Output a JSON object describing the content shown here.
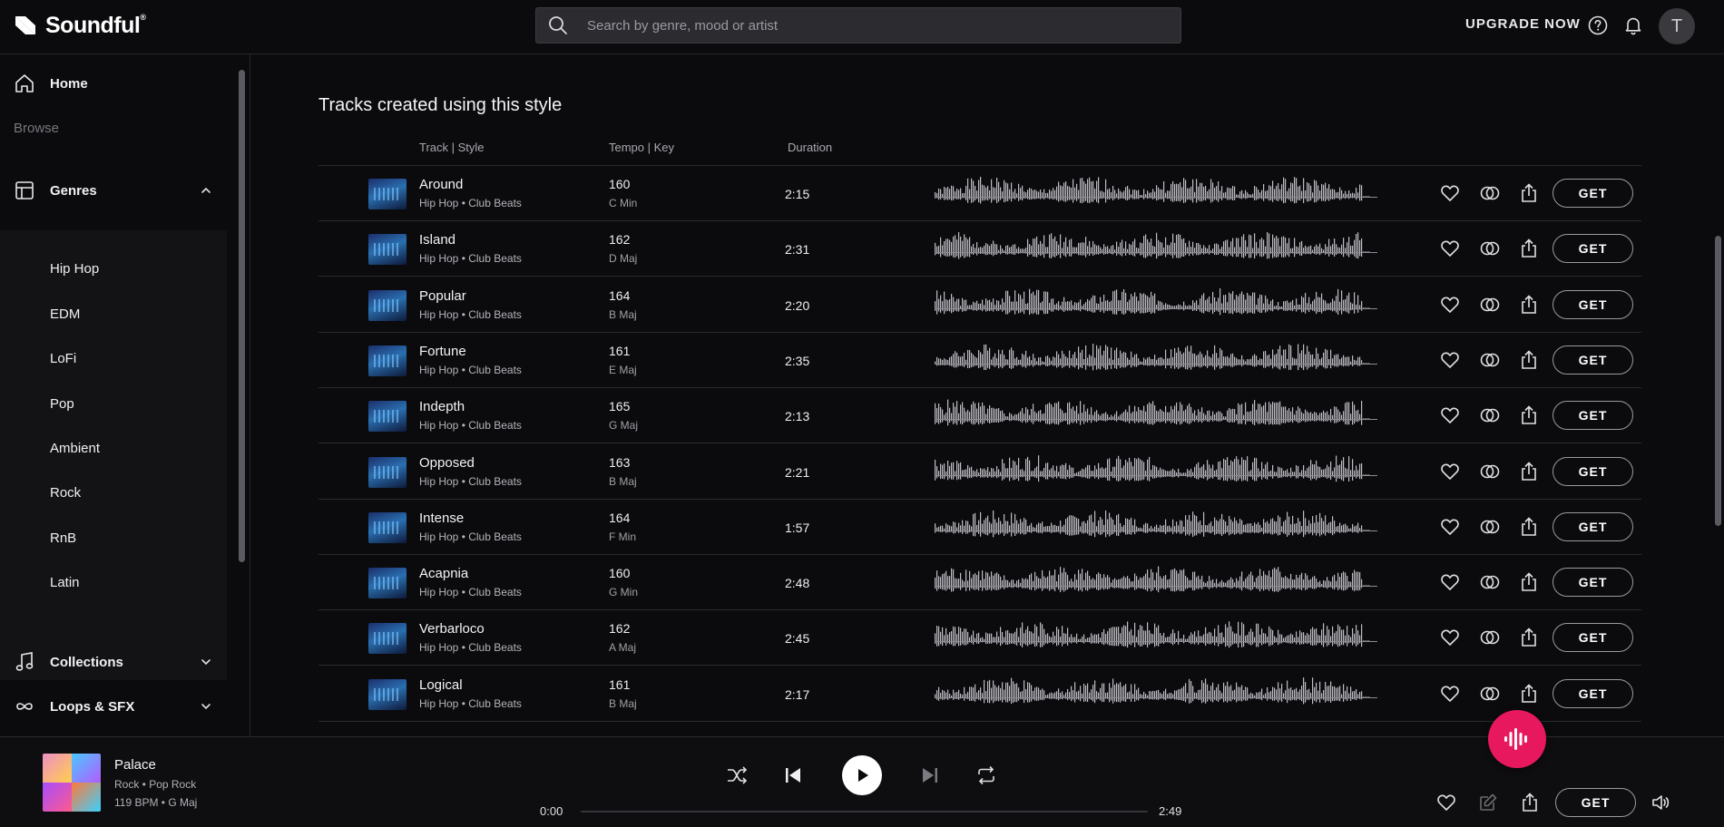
{
  "app": {
    "brand": "Soundful",
    "brand_mark": "®"
  },
  "header": {
    "search_placeholder": "Search by genre, mood or artist",
    "upgrade_label": "UPGRADE NOW",
    "avatar_initial": "T"
  },
  "sidebar": {
    "home_label": "Home",
    "browse_label": "Browse",
    "genres_label": "Genres",
    "genres": [
      "Hip Hop",
      "EDM",
      "LoFi",
      "Pop",
      "Ambient",
      "Rock",
      "RnB",
      "Latin"
    ],
    "collections_label": "Collections",
    "loops_label": "Loops & SFX"
  },
  "main": {
    "section_title": "Tracks created using this style",
    "columns": {
      "track_style": "Track | Style",
      "tempo_key": "Tempo | Key",
      "duration": "Duration"
    },
    "get_label": "GET",
    "tracks": [
      {
        "name": "Around",
        "style": "Hip Hop • Club Beats",
        "tempo": "160",
        "key": "C Min",
        "duration": "2:15"
      },
      {
        "name": "Island",
        "style": "Hip Hop • Club Beats",
        "tempo": "162",
        "key": "D Maj",
        "duration": "2:31"
      },
      {
        "name": "Popular",
        "style": "Hip Hop • Club Beats",
        "tempo": "164",
        "key": "B Maj",
        "duration": "2:20"
      },
      {
        "name": "Fortune",
        "style": "Hip Hop • Club Beats",
        "tempo": "161",
        "key": "E Maj",
        "duration": "2:35"
      },
      {
        "name": "Indepth",
        "style": "Hip Hop • Club Beats",
        "tempo": "165",
        "key": "G Maj",
        "duration": "2:13"
      },
      {
        "name": "Opposed",
        "style": "Hip Hop • Club Beats",
        "tempo": "163",
        "key": "B Maj",
        "duration": "2:21"
      },
      {
        "name": "Intense",
        "style": "Hip Hop • Club Beats",
        "tempo": "164",
        "key": "F Min",
        "duration": "1:57"
      },
      {
        "name": "Acapnia",
        "style": "Hip Hop • Club Beats",
        "tempo": "160",
        "key": "G Min",
        "duration": "2:48"
      },
      {
        "name": "Verbarloco",
        "style": "Hip Hop • Club Beats",
        "tempo": "162",
        "key": "A Maj",
        "duration": "2:45"
      },
      {
        "name": "Logical",
        "style": "Hip Hop • Club Beats",
        "tempo": "161",
        "key": "B Maj",
        "duration": "2:17"
      }
    ]
  },
  "player": {
    "title": "Palace",
    "style": "Rock • Pop Rock",
    "meta": "119 BPM • G Maj",
    "current_time": "0:00",
    "total_time": "2:49",
    "progress": 0,
    "get_label": "GET"
  },
  "colors": {
    "accent": "#e8185e",
    "background": "#0b0b0e",
    "panel": "#131316"
  },
  "icons": {
    "search": "search-icon",
    "help": "help-icon",
    "bell": "bell-icon",
    "home": "home-icon",
    "genres": "grid-icon",
    "collections": "music-note-icon",
    "loops": "infinity-icon",
    "heart": "heart-icon",
    "stems": "stems-icon",
    "share": "share-icon",
    "shuffle": "shuffle-icon",
    "previous": "previous-icon",
    "play": "play-icon",
    "next": "next-icon",
    "repeat": "repeat-icon",
    "edit": "edit-icon",
    "volume": "volume-icon",
    "fab": "waveform-icon"
  }
}
